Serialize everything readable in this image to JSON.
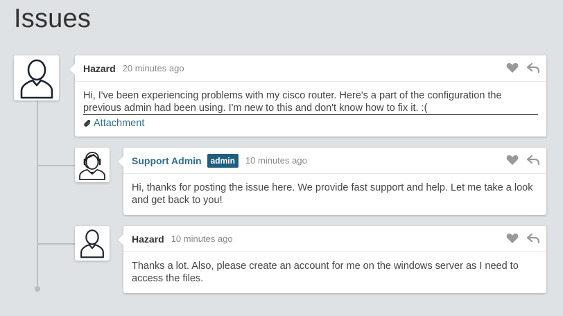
{
  "page": {
    "title": "Issues"
  },
  "comments": [
    {
      "author": "Hazard",
      "time": "20 minutes ago",
      "text_line1": "Hi, I've been experiencing problems with my cisco router. Here's a part of the configuration the",
      "text_line2": "previous admin had been using. I'm new to this and don't know how to fix it. :(",
      "attachment_label": "Attachment",
      "avatar": "user-icon"
    },
    {
      "author": "Support Admin",
      "badge": "admin",
      "time": "10 minutes ago",
      "text": "Hi, thanks for posting the issue here. We provide fast support and help. Let me take a look and get back to you!",
      "avatar": "support-agent-icon"
    },
    {
      "author": "Hazard",
      "time": "10 minutes ago",
      "text": "Thanks a lot. Also, please create an account for me on the windows server as I need to access the files.",
      "avatar": "user-icon"
    }
  ],
  "icons": {
    "like": "heart-icon",
    "reply": "reply-icon",
    "attachment": "paperclip-icon"
  },
  "colors": {
    "background": "#dfe2e5",
    "link": "#2a6f8f",
    "badge": "#1f5e7e",
    "icon": "#999999"
  }
}
